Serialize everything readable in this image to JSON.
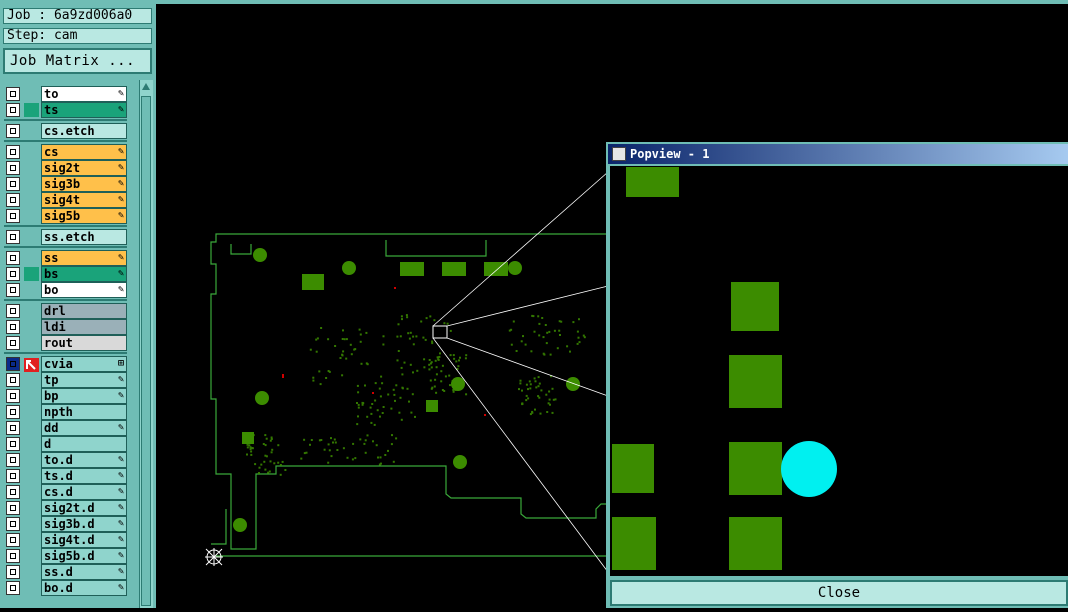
{
  "job": {
    "label": "Job : 6a9zd006a0",
    "step": "Step: cam"
  },
  "job_matrix_label": "Job Matrix ...",
  "layers": [
    {
      "name": "to",
      "color": "#ffffff",
      "icon": "✎"
    },
    {
      "name": "ts",
      "color": "#1aa37a",
      "icon": "✎"
    },
    {
      "name": "cs.etch",
      "color": "#b9e8e2",
      "icon": ""
    },
    {
      "name": "cs",
      "color": "#ffc04a",
      "icon": "✎"
    },
    {
      "name": "sig2t",
      "color": "#ffc04a",
      "icon": "✎"
    },
    {
      "name": "sig3b",
      "color": "#ffc04a",
      "icon": "✎"
    },
    {
      "name": "sig4t",
      "color": "#ffc04a",
      "icon": "✎"
    },
    {
      "name": "sig5b",
      "color": "#ffc04a",
      "icon": "✎"
    },
    {
      "name": "ss.etch",
      "color": "#b9e8e2",
      "icon": ""
    },
    {
      "name": "ss",
      "color": "#ffc04a",
      "icon": "✎"
    },
    {
      "name": "bs",
      "color": "#1aa37a",
      "icon": "✎"
    },
    {
      "name": "bo",
      "color": "#ffffff",
      "icon": "✎"
    },
    {
      "name": "drl",
      "color": "#9ab0b8",
      "icon": ""
    },
    {
      "name": "ldi",
      "color": "#9ab0b8",
      "icon": ""
    },
    {
      "name": "rout",
      "color": "#d9d9d9",
      "icon": ""
    },
    {
      "name": "cvia",
      "color": "#8fd4cc",
      "icon": "⊞"
    },
    {
      "name": "tp",
      "color": "#8fd4cc",
      "icon": "✎"
    },
    {
      "name": "bp",
      "color": "#8fd4cc",
      "icon": "✎"
    },
    {
      "name": "npth",
      "color": "#8fd4cc",
      "icon": ""
    },
    {
      "name": "dd",
      "color": "#8fd4cc",
      "icon": "✎"
    },
    {
      "name": "d",
      "color": "#8fd4cc",
      "icon": ""
    },
    {
      "name": "to.d",
      "color": "#8fd4cc",
      "icon": "✎"
    },
    {
      "name": "ts.d",
      "color": "#8fd4cc",
      "icon": "✎"
    },
    {
      "name": "cs.d",
      "color": "#8fd4cc",
      "icon": "✎"
    },
    {
      "name": "sig2t.d",
      "color": "#8fd4cc",
      "icon": "✎"
    },
    {
      "name": "sig3b.d",
      "color": "#8fd4cc",
      "icon": "✎"
    },
    {
      "name": "sig4t.d",
      "color": "#8fd4cc",
      "icon": "✎"
    },
    {
      "name": "sig5b.d",
      "color": "#8fd4cc",
      "icon": "✎"
    },
    {
      "name": "ss.d",
      "color": "#8fd4cc",
      "icon": "✎"
    },
    {
      "name": "bo.d",
      "color": "#8fd4cc",
      "icon": "✎"
    }
  ],
  "popup": {
    "title": "Popview - 1",
    "close_label": "Close"
  },
  "colors": {
    "board_outline": "#3aa83a",
    "pad": "#3c8c00",
    "via_highlight": "#00f0f0"
  }
}
